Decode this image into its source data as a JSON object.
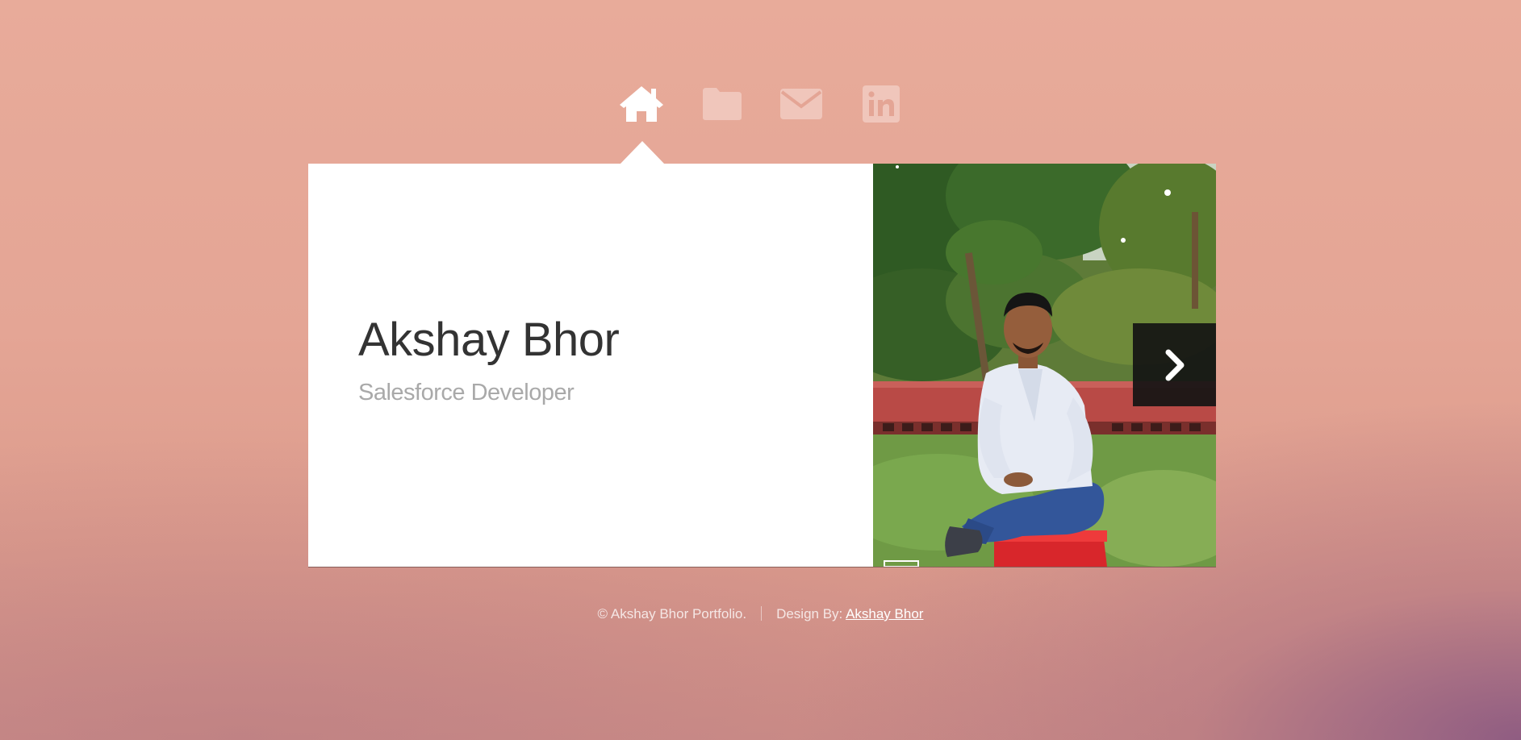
{
  "nav": {
    "items": [
      {
        "icon": "home-icon",
        "active": true
      },
      {
        "icon": "folder-icon",
        "active": false
      },
      {
        "icon": "mail-icon",
        "active": false
      },
      {
        "icon": "linkedin-icon",
        "active": false
      }
    ]
  },
  "profile": {
    "name": "Akshay Bhor",
    "role": "Salesforce Developer"
  },
  "photo": {
    "next_icon": "chevron-right-icon"
  },
  "footer": {
    "copyright": "© Akshay Bhor Portfolio.",
    "design_by_label": "Design By:",
    "design_by_link": "Akshay Bhor"
  },
  "colors": {
    "background_top": "#e8ab9a",
    "background_corner": "#8c5a82",
    "card": "#ffffff",
    "name_text": "#333333",
    "role_text": "#a9a9a9",
    "nav_active": "#ffffff",
    "nav_inactive": "#f0c6bb",
    "next_button": "#141414"
  }
}
